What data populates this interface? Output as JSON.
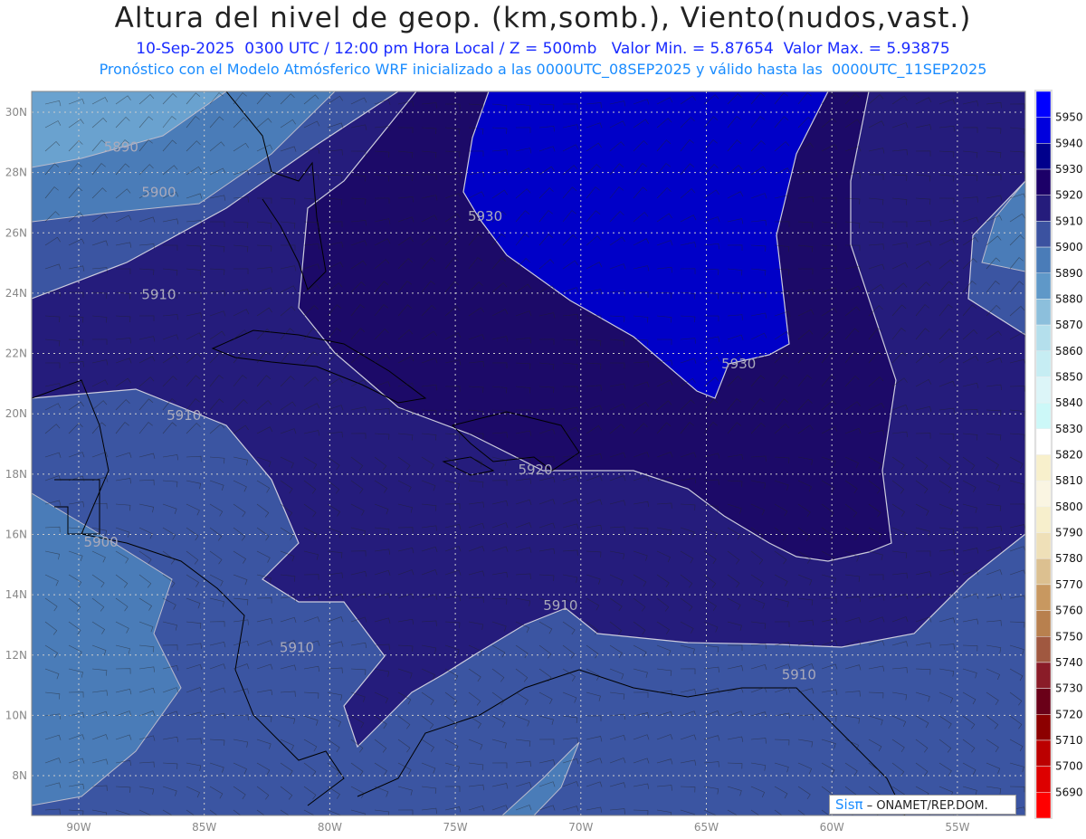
{
  "header": {
    "title": "Altura del nivel de geop. (km,somb.), Viento(nudos,vast.)",
    "subtitle": "10-Sep-2025  0300 UTC / 12:00 pm Hora Local / Z = 500mb   Valor Min. = 5.87654  Valor Max. = 5.93875",
    "info": "Pronóstico con el Modelo Atmósferico WRF inicializado a las 0000UTC_08SEP2025 y válido hasta las  0000UTC_11SEP2025"
  },
  "axes": {
    "lat_labels": [
      {
        "v": 30,
        "t": "30N"
      },
      {
        "v": 28,
        "t": "28N"
      },
      {
        "v": 26,
        "t": "26N"
      },
      {
        "v": 24,
        "t": "24N"
      },
      {
        "v": 22,
        "t": "22N"
      },
      {
        "v": 20,
        "t": "20N"
      },
      {
        "v": 18,
        "t": "18N"
      },
      {
        "v": 16,
        "t": "16N"
      },
      {
        "v": 14,
        "t": "14N"
      },
      {
        "v": 12,
        "t": "12N"
      },
      {
        "v": 10,
        "t": "10N"
      },
      {
        "v": 8,
        "t": "8N"
      }
    ],
    "lon_labels": [
      {
        "v": -90,
        "t": "90W"
      },
      {
        "v": -85,
        "t": "85W"
      },
      {
        "v": -80,
        "t": "80W"
      },
      {
        "v": -75,
        "t": "75W"
      },
      {
        "v": -70,
        "t": "70W"
      },
      {
        "v": -65,
        "t": "65W"
      },
      {
        "v": -60,
        "t": "60W"
      },
      {
        "v": -55,
        "t": "55W"
      }
    ]
  },
  "contour_labels": [
    {
      "t": "5890",
      "lon": -89,
      "lat": 28.7
    },
    {
      "t": "5900",
      "lon": -87.5,
      "lat": 27.2
    },
    {
      "t": "5930",
      "lon": -74.5,
      "lat": 26.4
    },
    {
      "t": "5910",
      "lon": -87.5,
      "lat": 23.8
    },
    {
      "t": "5930",
      "lon": -64.4,
      "lat": 21.5
    },
    {
      "t": "5910",
      "lon": -86.5,
      "lat": 19.8
    },
    {
      "t": "5920",
      "lon": -72.5,
      "lat": 18.0
    },
    {
      "t": "5900",
      "lon": -89.8,
      "lat": 15.6
    },
    {
      "t": "5910",
      "lon": -71.5,
      "lat": 13.5
    },
    {
      "t": "5910",
      "lon": -82,
      "lat": 12.1
    },
    {
      "t": "5910",
      "lon": -62,
      "lat": 11.2
    }
  ],
  "colorbar": {
    "labels": [
      "5950",
      "5940",
      "5930",
      "5920",
      "5910",
      "5900",
      "5890",
      "5880",
      "5870",
      "5860",
      "5850",
      "5840",
      "5830",
      "5820",
      "5810",
      "5800",
      "5790",
      "5780",
      "5770",
      "5760",
      "5750",
      "5740",
      "5730",
      "5720",
      "5710",
      "5700",
      "5690"
    ],
    "colors": [
      "#0000ff",
      "#0000dd",
      "#00008c",
      "#1c0068",
      "#251c7c",
      "#3b52a0",
      "#4a7cb8",
      "#5f98c8",
      "#8cbfdc",
      "#b4dfec",
      "#c6edf3",
      "#dcf5f8",
      "#ccf8f8",
      "#ffffff",
      "#f8f0cc",
      "#faf5e2",
      "#f7efcc",
      "#efe0b8",
      "#dcc090",
      "#c89860",
      "#b8804e",
      "#a05840",
      "#8a1c28",
      "#6a0018",
      "#8c0000",
      "#bb0000",
      "#dd0000",
      "#ff0000"
    ]
  },
  "credit": {
    "logo": "Sisπ",
    "text": "– ONAMET/REP.DOM."
  }
}
